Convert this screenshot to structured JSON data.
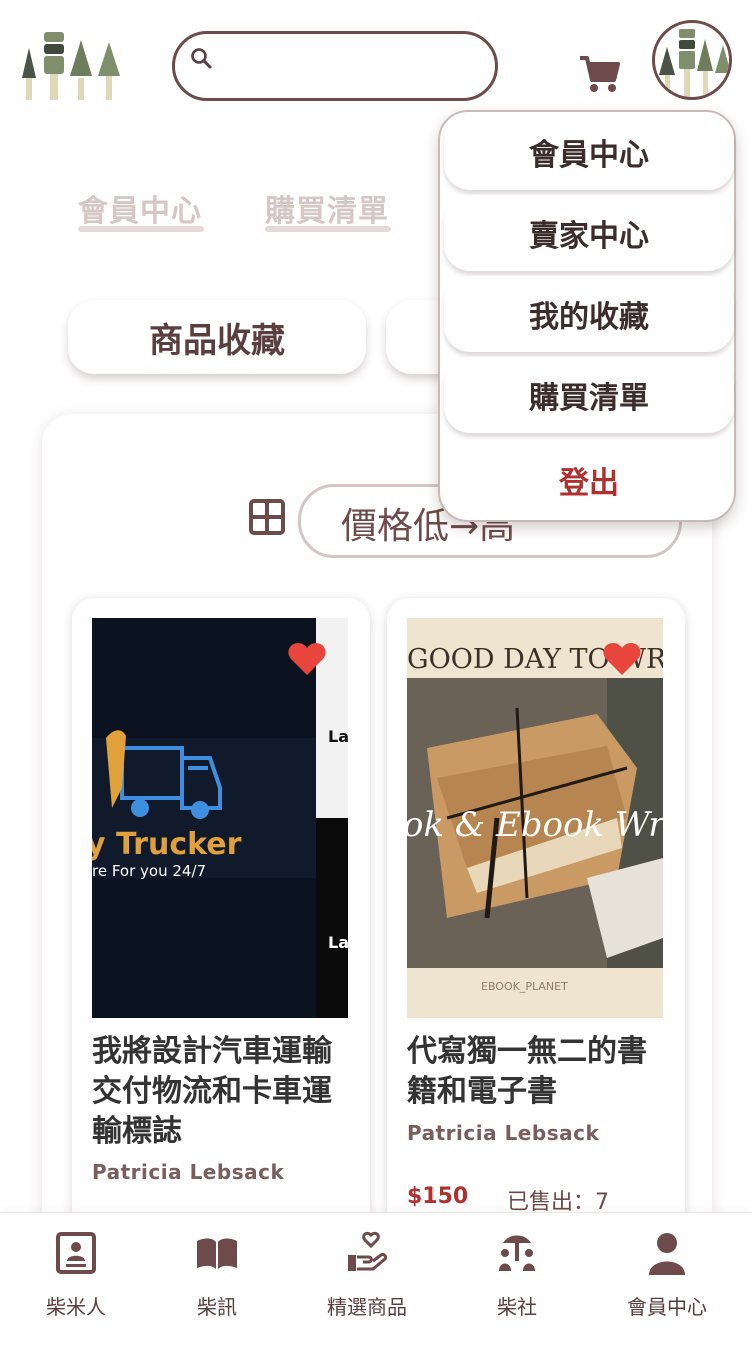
{
  "header": {
    "search_placeholder": "",
    "icons": [
      "tree-logo",
      "search-icon",
      "cart-icon",
      "avatar"
    ]
  },
  "tabs": [
    {
      "label": "會員中心"
    },
    {
      "label": "購買清單"
    }
  ],
  "category_buttons": [
    {
      "label": "商品收藏"
    }
  ],
  "toolbar": {
    "sort_selected": "價格低→高",
    "grid_icon": "grid-icon"
  },
  "products": [
    {
      "title": "我將設計汽車運輸交付物流和卡車運輸標誌",
      "seller": "Patricia Lebsack",
      "image_text": [
        "y Trucker",
        "re For you 24/7",
        "La",
        "La"
      ],
      "favorited": true
    },
    {
      "title": "代寫獨一無二的書籍和電子書",
      "seller": "Patricia Lebsack",
      "price": "$150",
      "sold": "已售出：7",
      "image_text": [
        "GOOD DAY TO WR",
        "ok & Ebook Wri",
        "EBOOK_PLANET"
      ],
      "favorited": true
    }
  ],
  "dropdown": {
    "items": [
      "會員中心",
      "賣家中心",
      "我的收藏",
      "購買清單"
    ],
    "logout": "登出"
  },
  "bottom_nav": [
    {
      "label": "柴米人",
      "icon": "profile-card-icon"
    },
    {
      "label": "柴訊",
      "icon": "book-icon"
    },
    {
      "label": "精選商品",
      "icon": "hand-heart-icon"
    },
    {
      "label": "柴社",
      "icon": "community-icon"
    },
    {
      "label": "會員中心",
      "icon": "user-icon"
    }
  ],
  "colors": {
    "brand_brown": "#6e4a4a",
    "accent_red": "#b03030",
    "heart_red": "#e8453c",
    "tree_green": "#6f7d5d"
  }
}
